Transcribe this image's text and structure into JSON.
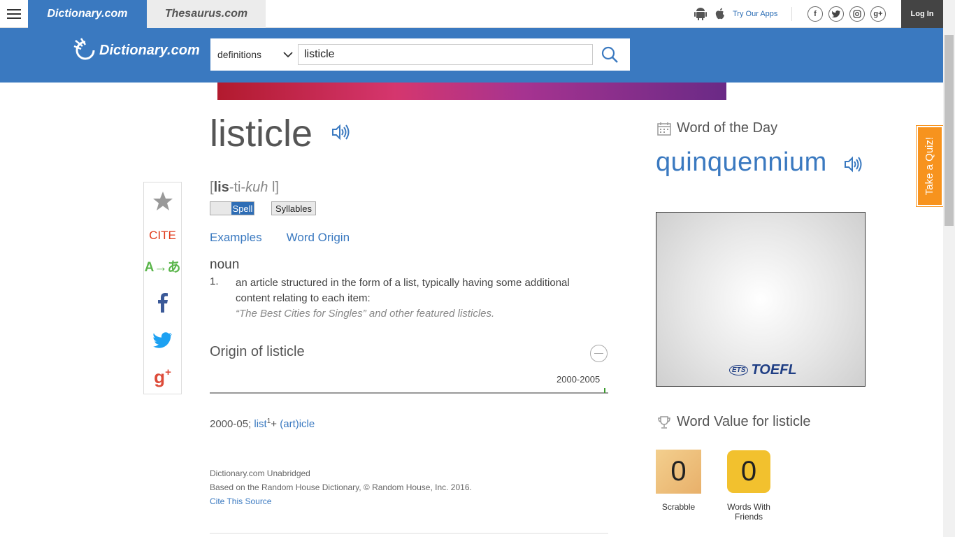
{
  "topbar": {
    "tab_dictionary": "Dictionary.com",
    "tab_thesaurus": "Thesaurus.com",
    "apps_label": "Try Our Apps",
    "login_label": "Log In",
    "social": [
      "f",
      "t",
      "ig",
      "g+"
    ]
  },
  "header": {
    "logo": "Dictionary.com",
    "search_mode": "definitions",
    "search_value": "listicle",
    "accent_color": "#3a79c0"
  },
  "sidebar": {
    "cite_label": "CITE",
    "translate_label": "A→あ"
  },
  "entry": {
    "word": "listicle",
    "pron_open": "[",
    "pron_stress": "lis",
    "pron_rest": "-ti-",
    "pron_italic": "kuh",
    "pron_end": " l]",
    "spell_label": "Spell",
    "syllables_label": "Syllables",
    "anchor_examples": "Examples",
    "anchor_origin": "Word Origin",
    "part_of_speech": "noun",
    "definition_number": "1.",
    "definition_text": "an article structured in the form of a list, typically having some additional content relating to each item:",
    "definition_example": "“The Best Cities for Singles” and other featured listicles.",
    "origin_title": "Origin of listicle",
    "origin_range": "2000-2005",
    "etymology_prefix": "2000-05; ",
    "etymology_link1": "list",
    "etymology_sup": "1",
    "etymology_plus": "+ ",
    "etymology_link2": "(art)icle",
    "source_name": "Dictionary.com Unabridged",
    "source_detail": "Based on the Random House Dictionary, © Random House, Inc. 2016.",
    "cite_source": "Cite This Source"
  },
  "right": {
    "wotd_heading": "Word of the Day",
    "wotd_word": "quinquennium",
    "ad_ets": "ETS",
    "ad_brand": "TOEFL",
    "word_value_heading": "Word Value for listicle",
    "scrabble_value": "0",
    "scrabble_label": "Scrabble",
    "wwf_value": "0",
    "wwf_label": "Words With Friends"
  },
  "quiz_tab": "Take a Quiz!"
}
